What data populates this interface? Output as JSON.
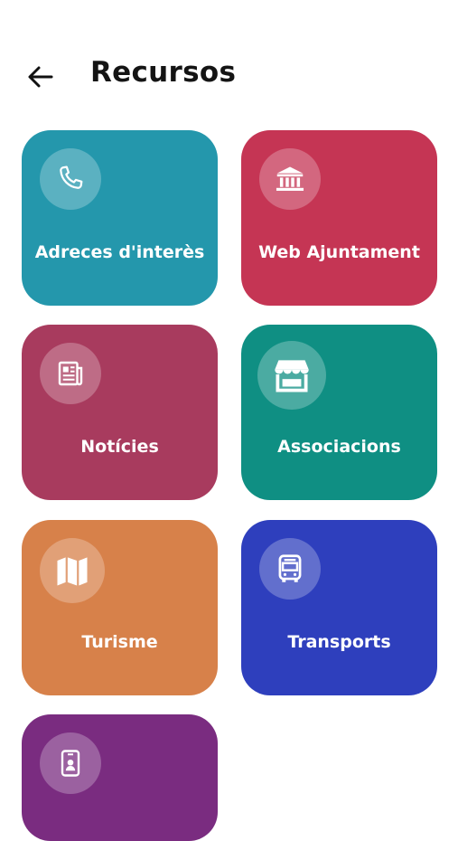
{
  "header": {
    "back_icon": "arrow-left-icon",
    "title": "Recursos"
  },
  "tiles": [
    {
      "label": "Adreces d'interès",
      "icon": "phone-icon",
      "color": "#2497ac"
    },
    {
      "label": "Web Ajuntament",
      "icon": "town-hall-icon",
      "color": "#c53554"
    },
    {
      "label": "Notícies",
      "icon": "newspaper-icon",
      "color": "#a83b5e"
    },
    {
      "label": "Associacions",
      "icon": "store-icon",
      "color": "#0f8f83"
    },
    {
      "label": "Turisme",
      "icon": "map-icon",
      "color": "#d7814a"
    },
    {
      "label": "Transports",
      "icon": "bus-icon",
      "color": "#2e3fbd"
    },
    {
      "label": "",
      "icon": "id-badge-icon",
      "color": "#7a2c80"
    }
  ]
}
